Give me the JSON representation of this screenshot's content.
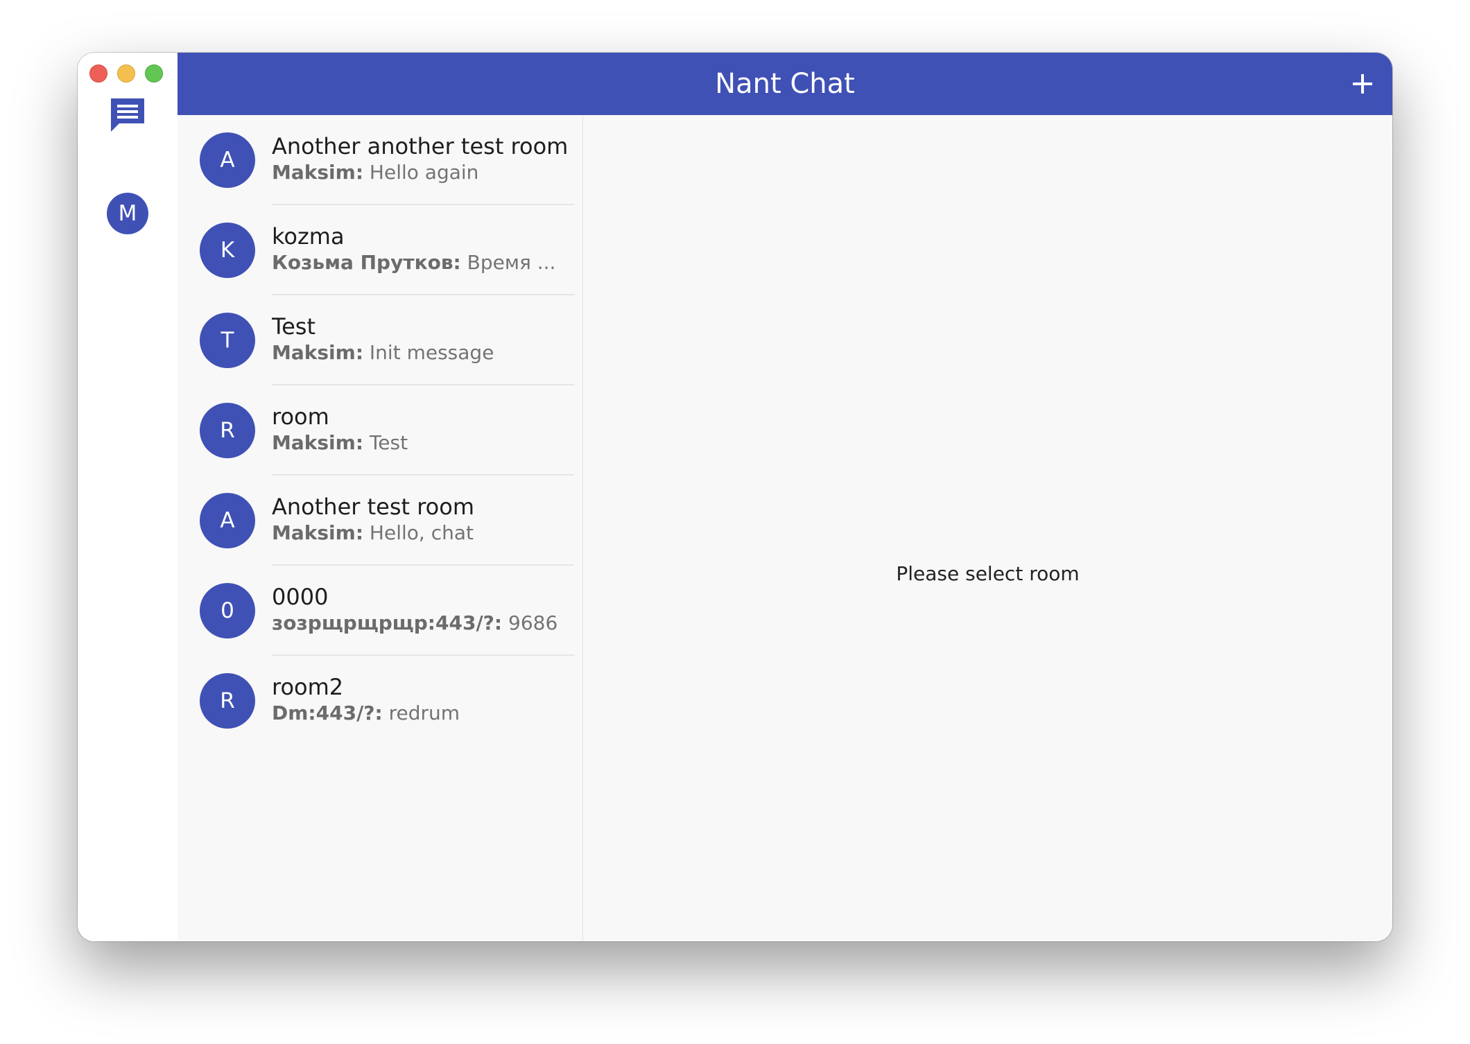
{
  "header": {
    "title": "Nant Chat",
    "add_icon": "plus-icon"
  },
  "rail": {
    "chat_icon": "chat-bubble-icon",
    "user_initial": "M"
  },
  "rooms": [
    {
      "initial": "A",
      "name": "Another another test room",
      "sender": "Maksim:",
      "message": " Hello again"
    },
    {
      "initial": "K",
      "name": "kozma",
      "sender": "Козьма Прутков:",
      "message": " Время ..."
    },
    {
      "initial": "T",
      "name": "Test",
      "sender": "Maksim:",
      "message": " Init message"
    },
    {
      "initial": "R",
      "name": "room",
      "sender": "Maksim:",
      "message": " Test"
    },
    {
      "initial": "A",
      "name": "Another test room",
      "sender": "Maksim:",
      "message": " Hello, chat"
    },
    {
      "initial": "0",
      "name": "0000",
      "sender": "зозрщрщрщр:443/?:",
      "message": " 9686"
    },
    {
      "initial": "R",
      "name": "room2",
      "sender": "Dm:443/?:",
      "message": " redrum"
    }
  ],
  "main": {
    "placeholder": "Please select room"
  },
  "colors": {
    "accent": "#3f51b5",
    "background": "#f8f8f8"
  }
}
